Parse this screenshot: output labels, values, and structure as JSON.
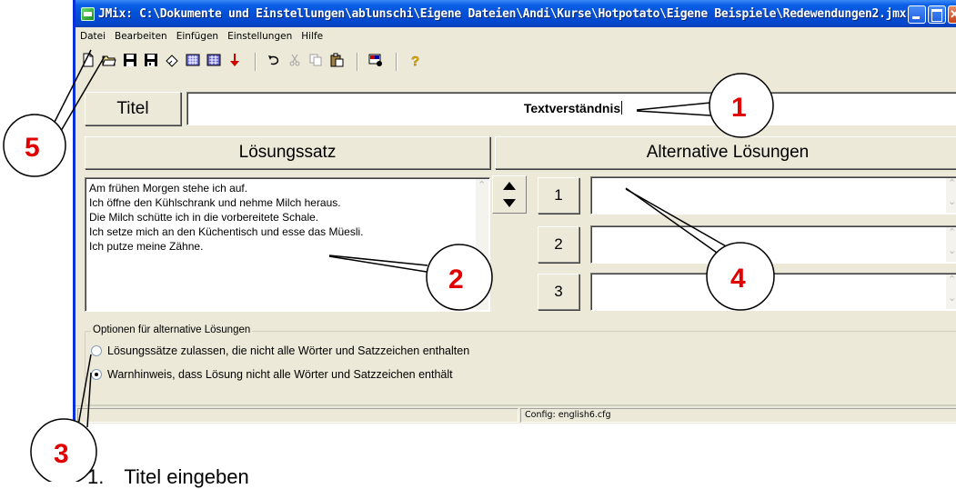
{
  "window": {
    "title": "JMix: C:\\Dokumente und Einstellungen\\ablunschi\\Eigene Dateien\\Andi\\Kurse\\Hotpotato\\Eigene Beispiele\\Redewendungen2.jmx"
  },
  "menu": {
    "items": [
      "Datei",
      "Bearbeiten",
      "Einfügen",
      "Einstellungen",
      "Hilfe"
    ]
  },
  "toolbar": {
    "icons": [
      "new-file-icon",
      "open-folder-icon",
      "save-icon",
      "save-as-icon",
      "eraser-icon",
      "export-web-icon",
      "export-web-alt-icon",
      "arrow-down-red-icon",
      "undo-icon",
      "cut-icon",
      "copy-icon",
      "paste-icon",
      "config-icon",
      "help-icon"
    ]
  },
  "title_row": {
    "label": "Titel",
    "value": "Textverständnis"
  },
  "solution": {
    "header": "Lösungssatz",
    "lines": [
      "Am frühen Morgen stehe ich auf.",
      "Ich öffne den Kühlschrank und nehme Milch heraus.",
      "Die Milch schütte ich in die vorbereitete Schale.",
      "Ich setze mich an den Küchentisch und esse das Müesli.",
      "Ich putze meine Zähne."
    ]
  },
  "alternatives": {
    "header": "Alternative Lösungen",
    "rows": [
      {
        "number": "1",
        "value": ""
      },
      {
        "number": "2",
        "value": ""
      },
      {
        "number": "3",
        "value": ""
      }
    ]
  },
  "options": {
    "legend": "Optionen für alternative Lösungen",
    "radios": [
      {
        "label": "Lösungssätze zulassen, die nicht alle Wörter und Satzzeichen enthalten",
        "checked": false
      },
      {
        "label": "Warnhinweis, dass Lösung nicht alle Wörter und Satzzeichen enthält",
        "checked": true
      }
    ]
  },
  "status": {
    "config": "Config: english6.cfg"
  },
  "annotations": {
    "numbers": [
      "1",
      "2",
      "3",
      "4",
      "5"
    ],
    "color": "#e00000"
  },
  "caption": {
    "number": "1.",
    "text": "Titel eingeben"
  }
}
